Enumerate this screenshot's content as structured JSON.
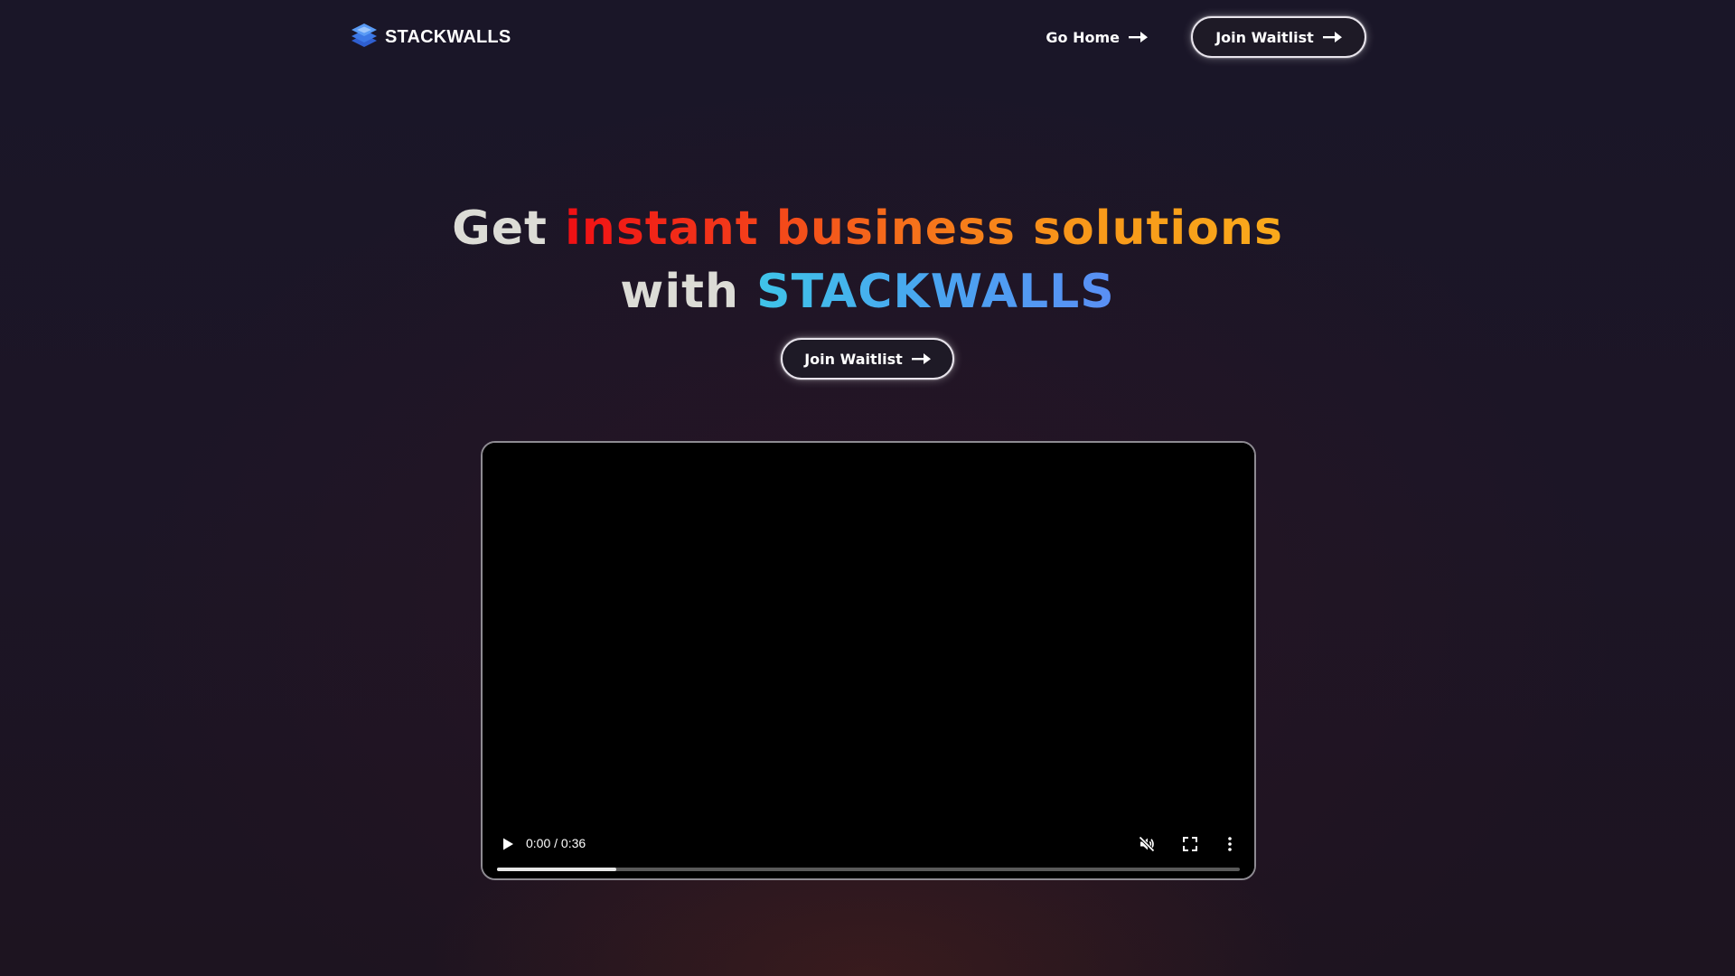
{
  "header": {
    "brand_name": "STACKWALLS",
    "brand_icon": "stacked-layers-logo",
    "nav": {
      "home_label": "Go Home",
      "waitlist_label": "Join Waitlist"
    }
  },
  "hero": {
    "line1_prefix": "Get",
    "line1_highlight": "instant business solutions",
    "line2_prefix": "with",
    "line2_brand": "STACKWALLS",
    "cta_label": "Join Waitlist"
  },
  "video": {
    "time_display": "0:00 / 0:36",
    "current_time": "0:00",
    "duration": "0:36",
    "buffered_fraction": 0.16,
    "muted": true,
    "icons": [
      "play-icon",
      "muted-volume-icon",
      "fullscreen-icon",
      "more-options-icon"
    ]
  },
  "colors": {
    "background": "#1b1626",
    "heading_white": "#dcdcd6",
    "highlight_start": "#f00f14",
    "highlight_end": "#f9aa1b",
    "brand_start": "#3fc4e8",
    "brand_end": "#5a8ff5",
    "button_border": "#e8e4ec"
  }
}
